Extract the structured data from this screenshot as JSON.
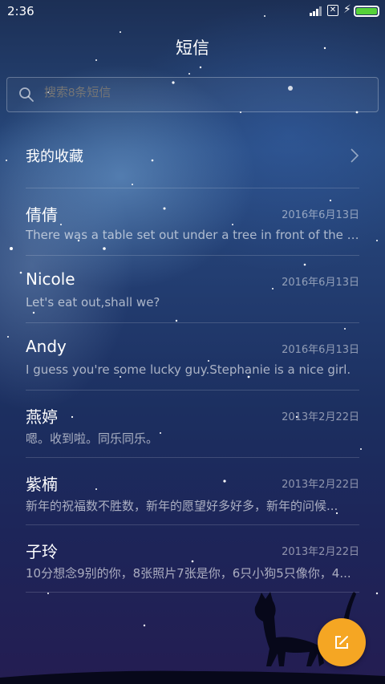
{
  "status_bar": {
    "time": "2:36"
  },
  "header": {
    "title": "短信"
  },
  "search": {
    "placeholder": "搜索8条短信"
  },
  "favorites": {
    "label": "我的收藏"
  },
  "threads": [
    {
      "name": "倩倩",
      "date": "2016年6月13日",
      "preview": "There was a table set out under a tree in front of the house..."
    },
    {
      "name": "Nicole",
      "date": "2016年6月13日",
      "preview": "Let's eat out,shall we?"
    },
    {
      "name": "Andy",
      "date": "2016年6月13日",
      "preview": "I guess you're some lucky guy.Stephanie is a nice girl."
    },
    {
      "name": "燕婷",
      "date": "2013年2月22日",
      "preview": "嗯。收到啦。同乐同乐。"
    },
    {
      "name": "紫楠",
      "date": "2013年2月22日",
      "preview": "新年的祝福数不胜数，新年的愿望好多好多，新年的问候..."
    },
    {
      "name": "子玲",
      "date": "2013年2月22日",
      "preview": "10分想念9别的你，8张照片7张是你，6只小狗5只像你，4..."
    }
  ],
  "colors": {
    "accent": "#f5a623",
    "battery": "#56d23a"
  },
  "icons": {
    "search": "search-icon",
    "chevron": "chevron-right-icon",
    "compose": "compose-icon"
  }
}
